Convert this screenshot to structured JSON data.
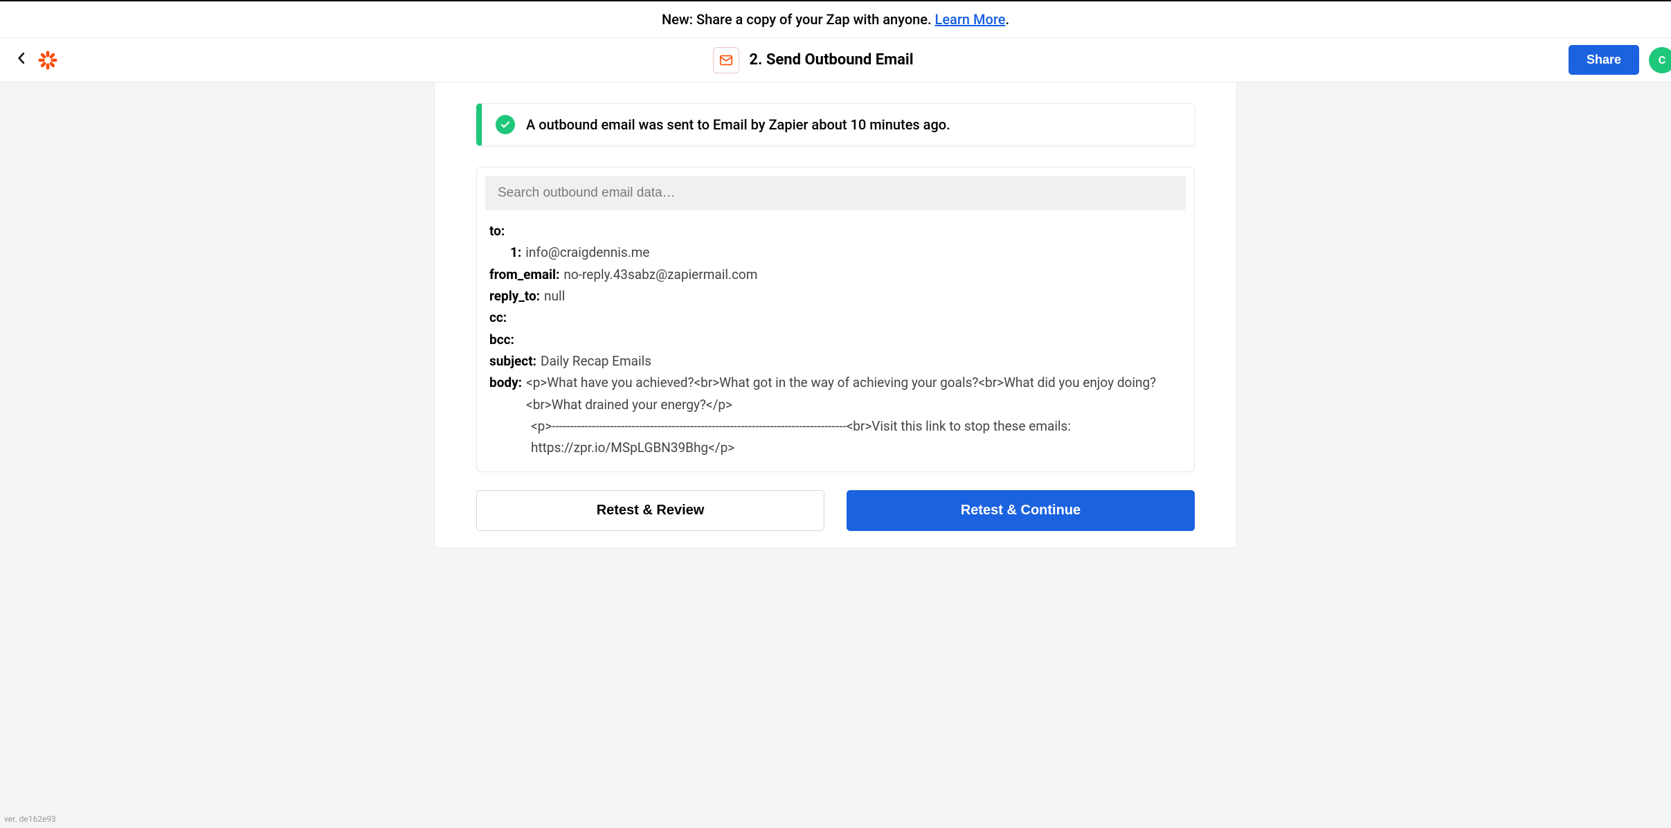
{
  "banner": {
    "prefix": "New: Share a copy of your Zap with anyone. ",
    "link_text": "Learn More",
    "suffix": "."
  },
  "header": {
    "step_title": "2. Send Outbound Email",
    "share_label": "Share",
    "avatar_initial": "C"
  },
  "success": {
    "message": "A outbound email was sent to Email by Zapier about 10 minutes ago."
  },
  "search": {
    "placeholder": "Search outbound email data…"
  },
  "data": {
    "to_label": "to:",
    "to_index_label": "1:",
    "to_value": "info@craigdennis.me",
    "from_email_label": "from_email:",
    "from_email_value": "no-reply.43sabz@zapiermail.com",
    "reply_to_label": "reply_to:",
    "reply_to_value": "null",
    "cc_label": "cc:",
    "bcc_label": "bcc:",
    "subject_label": "subject:",
    "subject_value": "Daily Recap Emails",
    "body_label": "body:",
    "body_line1": "<p>What have you achieved?<br>What got in the way of achieving your goals?<br>What did you enjoy doing?<br>What drained your energy?</p>",
    "body_line2": "<p>---------------------------------------------------------------------------------<br>Visit this link to stop these emails: https://zpr.io/MSpLGBN39Bhg</p>"
  },
  "buttons": {
    "retest_review": "Retest & Review",
    "retest_continue": "Retest & Continue"
  },
  "version": "ver. de162e93"
}
